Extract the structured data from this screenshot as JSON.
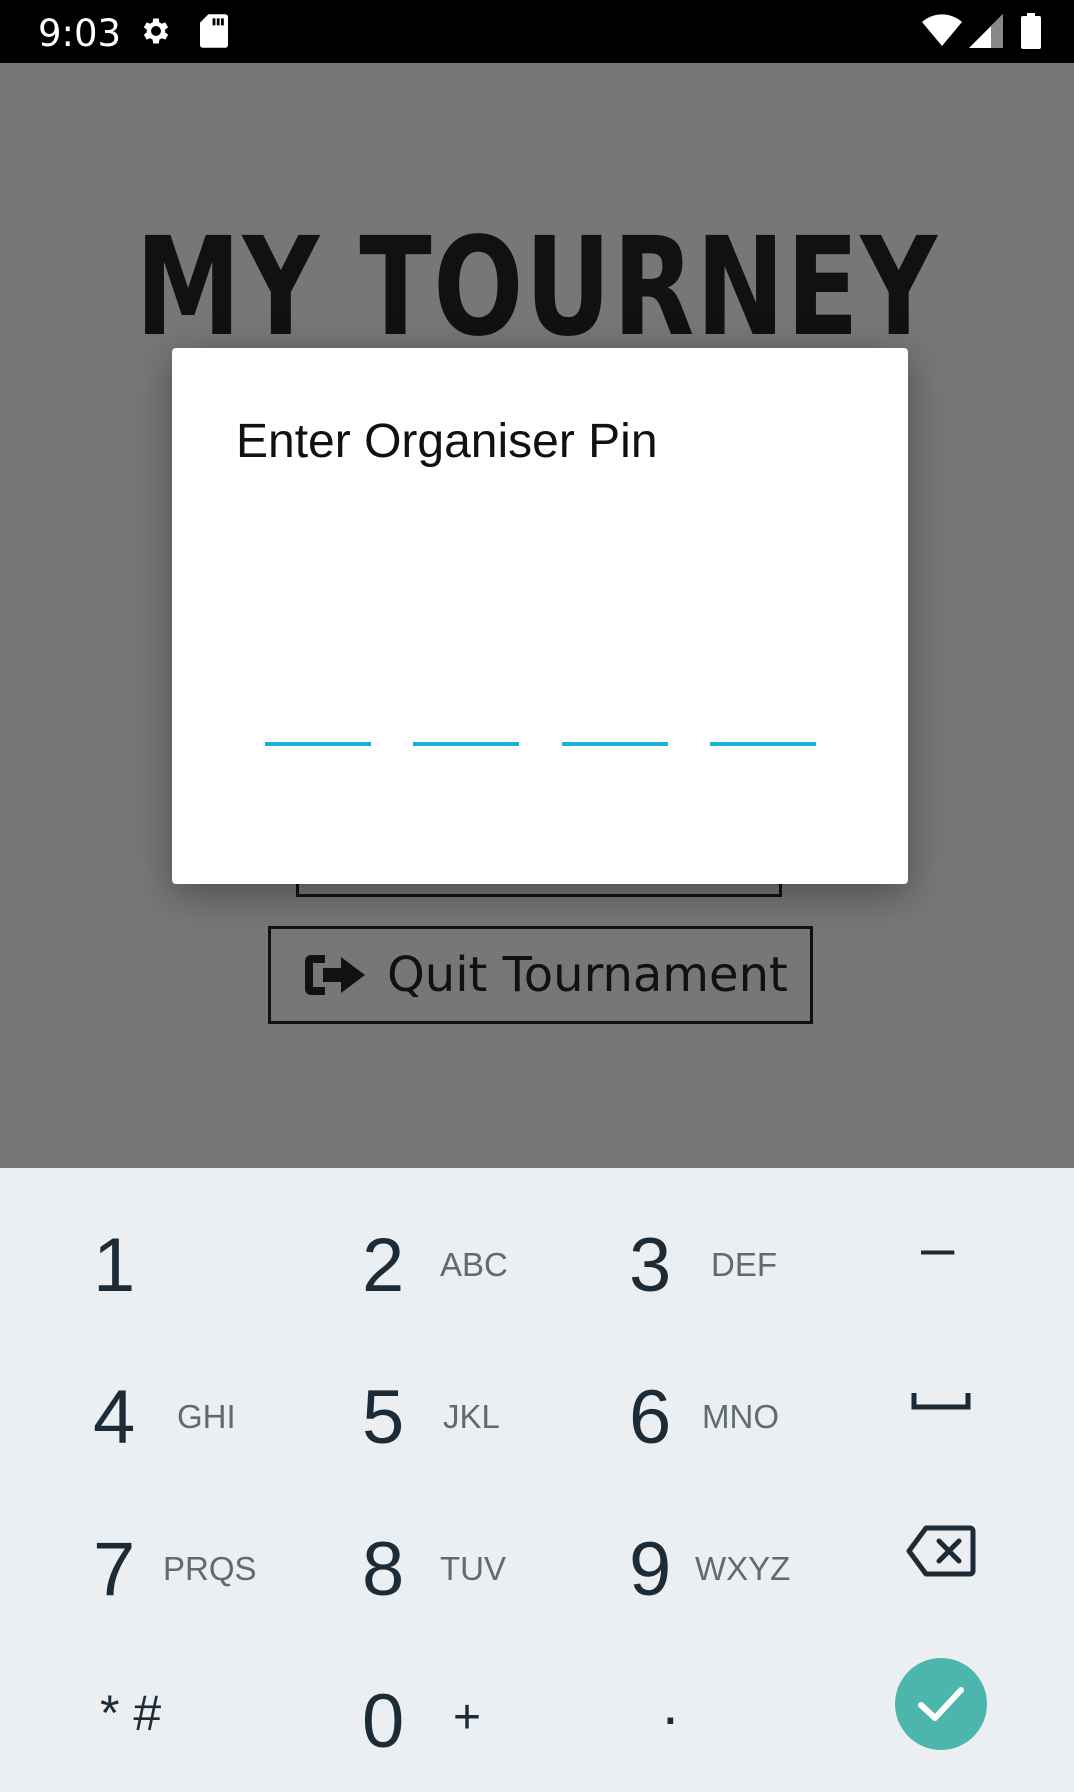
{
  "status_bar": {
    "time": "9:03"
  },
  "app": {
    "title": "MY TOURNEY",
    "quit_button_label": "Quit Tournament"
  },
  "dialog": {
    "title": "Enter Organiser Pin",
    "pin_length": 4
  },
  "keypad": {
    "rows": [
      [
        {
          "num": "1",
          "letters": ""
        },
        {
          "num": "2",
          "letters": "ABC"
        },
        {
          "num": "3",
          "letters": "DEF"
        },
        {
          "num": "–",
          "letters": ""
        }
      ],
      [
        {
          "num": "4",
          "letters": "GHI"
        },
        {
          "num": "5",
          "letters": "JKL"
        },
        {
          "num": "6",
          "letters": "MNO"
        },
        {
          "num": "␣",
          "letters": ""
        }
      ],
      [
        {
          "num": "7",
          "letters": "PRQS"
        },
        {
          "num": "8",
          "letters": "TUV"
        },
        {
          "num": "9",
          "letters": "WXYZ"
        },
        {
          "num": "backspace",
          "letters": ""
        }
      ],
      [
        {
          "num": "* #",
          "letters": ""
        },
        {
          "num": "0",
          "letters": "+"
        },
        {
          "num": ".",
          "letters": ""
        },
        {
          "num": "done",
          "letters": ""
        }
      ]
    ]
  },
  "colors": {
    "accent": "#16b4d2",
    "done": "#4db6ac",
    "keypad_bg": "#eceff1",
    "scrim": "#777777"
  },
  "icons": [
    "gear-icon",
    "sd-card-icon",
    "wifi-icon",
    "signal-icon",
    "battery-icon",
    "exit-icon",
    "backspace-icon",
    "check-icon"
  ]
}
